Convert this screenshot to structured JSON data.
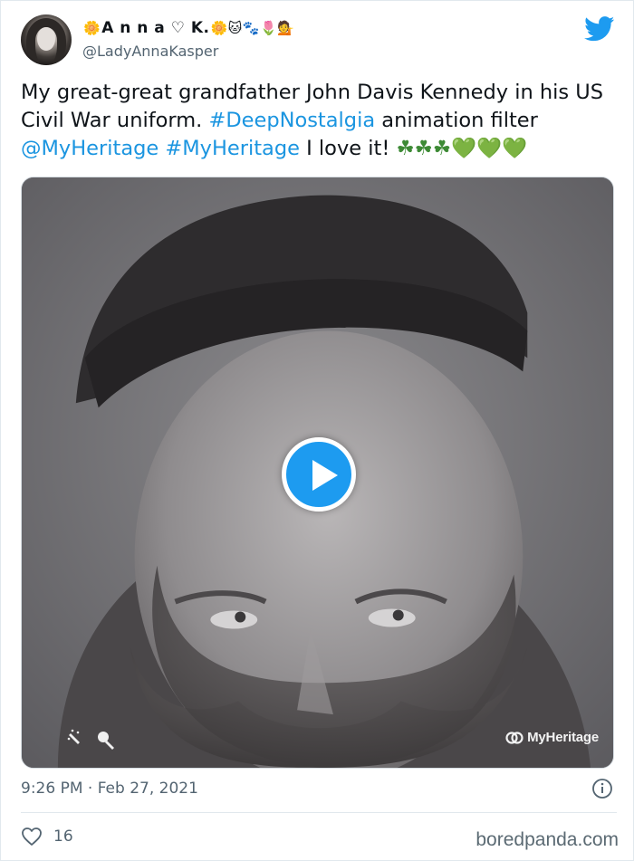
{
  "user": {
    "display_name_prefix": "🌼",
    "display_name": "A n n a ♡ K.",
    "display_name_suffix": "🌼🐱🐾🌷💁",
    "handle": "@LadyAnnaKasper"
  },
  "tweet": {
    "text_segments": [
      "My great-great grandfather John Davis Kennedy in his US Civil War uniform. ",
      "#DeepNostalgia",
      " animation filter ",
      "@MyHeritage",
      " ",
      "#MyHeritage",
      " I love it! ",
      "☘☘☘",
      "💚💚💚"
    ],
    "timestamp": "9:26 PM · Feb 27, 2021",
    "like_count": "16"
  },
  "media": {
    "watermark": "MyHeritage"
  },
  "source": "boredpanda.com",
  "colors": {
    "link": "#1b95e0",
    "twitter_blue": "#1d9bf0",
    "muted_text": "#536471"
  },
  "icons": {
    "brand": "twitter-bird-icon",
    "play": "play-icon",
    "info": "info-icon",
    "like": "heart-outline-icon"
  }
}
